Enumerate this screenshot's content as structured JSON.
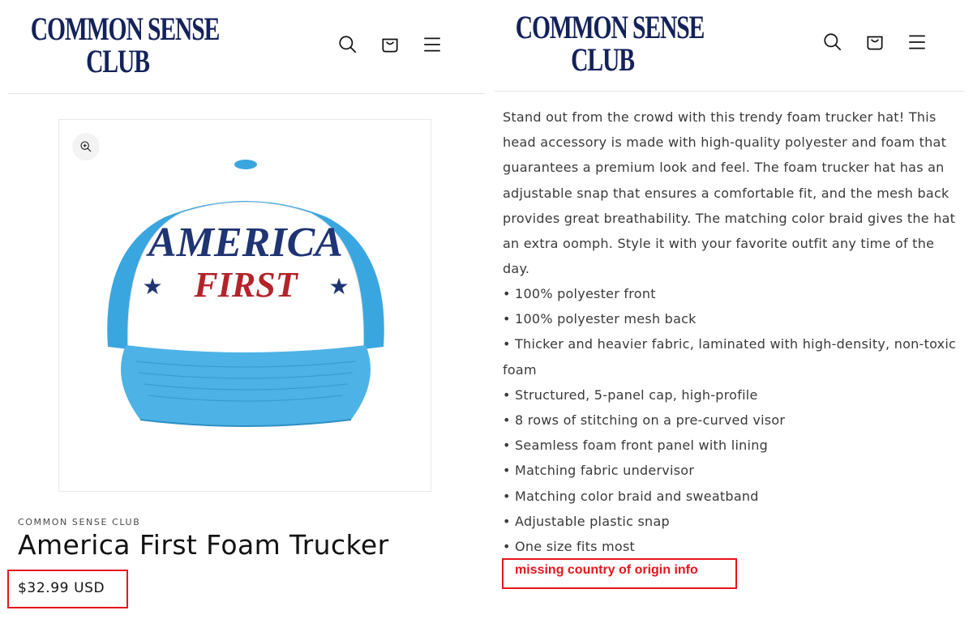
{
  "brand": {
    "logo_line1": "COMMON SENSE",
    "logo_line2": "CLUB"
  },
  "header_icons": [
    "search-icon",
    "cart-icon",
    "menu-icon"
  ],
  "product": {
    "vendor": "COMMON SENSE CLUB",
    "title": "America First Foam Trucker",
    "price": "$32.99 USD",
    "hat_text_line1": "AMERICA",
    "hat_text_line2": "FIRST",
    "description": "Stand out from the crowd with this trendy foam trucker hat! This head accessory is made with high-quality polyester and foam that guarantees a premium look and feel. The foam trucker hat has an adjustable snap that ensures a comfortable fit, and the mesh back provides great breathability. The matching color braid gives the hat an extra oomph. Style it with your favorite outfit any time of the day.",
    "features": [
      "• 100% polyester front",
      "• 100% polyester mesh back",
      "• Thicker and heavier fabric, laminated with high-density, non-toxic foam",
      "• Structured, 5-panel cap, high-profile",
      "• 8 rows of stitching on a pre-curved visor",
      "• Seamless foam front panel with lining",
      "• Matching fabric undervisor",
      "• Matching color braid and sweatband",
      "• Adjustable plastic snap",
      "• One size fits most"
    ]
  },
  "annotation": {
    "note": "missing country of origin info"
  },
  "colors": {
    "brand_navy": "#14225a",
    "highlight_red": "#e8141b",
    "hat_blue": "#3aa6e0",
    "hat_text_navy": "#1f3473",
    "hat_text_red": "#b3242a"
  }
}
